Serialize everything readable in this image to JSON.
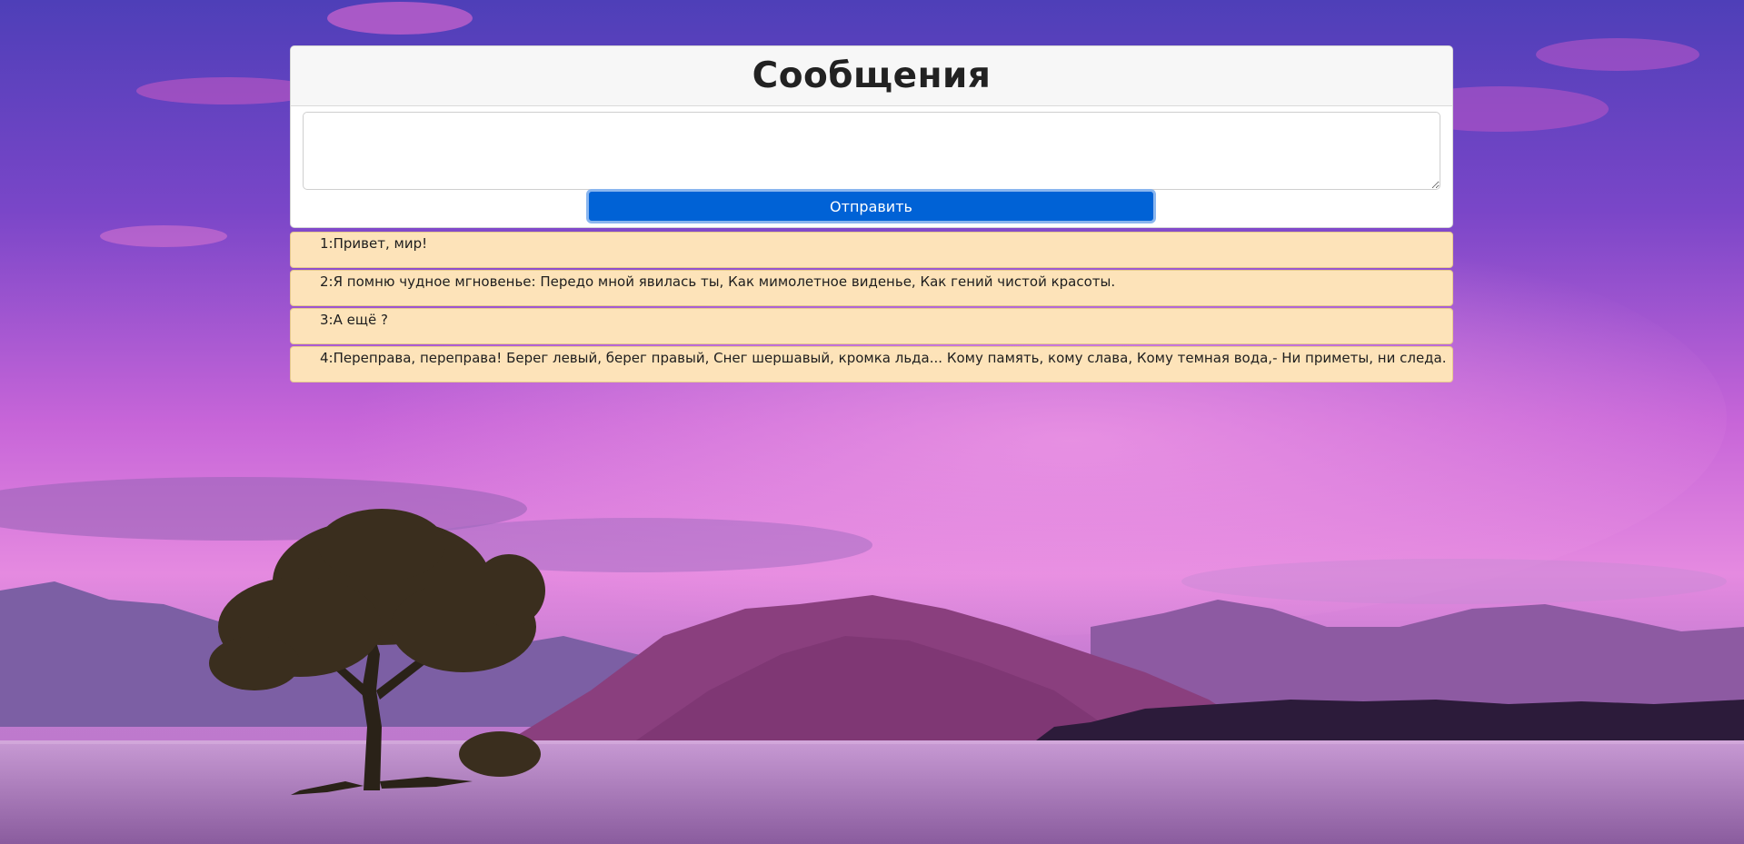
{
  "header": {
    "title": "Сообщения"
  },
  "form": {
    "input_value": "",
    "send_label": "Отправить"
  },
  "messages": [
    {
      "id": "1",
      "text": "Привет, мир!"
    },
    {
      "id": "2",
      "text": "Я помню чудное мгновенье: Передо мной явилась ты, Как мимолетное виденье, Как гений чистой красоты."
    },
    {
      "id": "3",
      "text": "А ещё ?"
    },
    {
      "id": "4",
      "text": "Переправа, переправа! Берег левый, берег правый, Снег шершавый, кромка льда... Кому память, кому слава, Кому темная вода,- Ни приметы, ни следа."
    }
  ],
  "colors": {
    "button": "#0062d6",
    "message_bg": "#fde3b9",
    "header_bg": "#f7f7f7"
  }
}
